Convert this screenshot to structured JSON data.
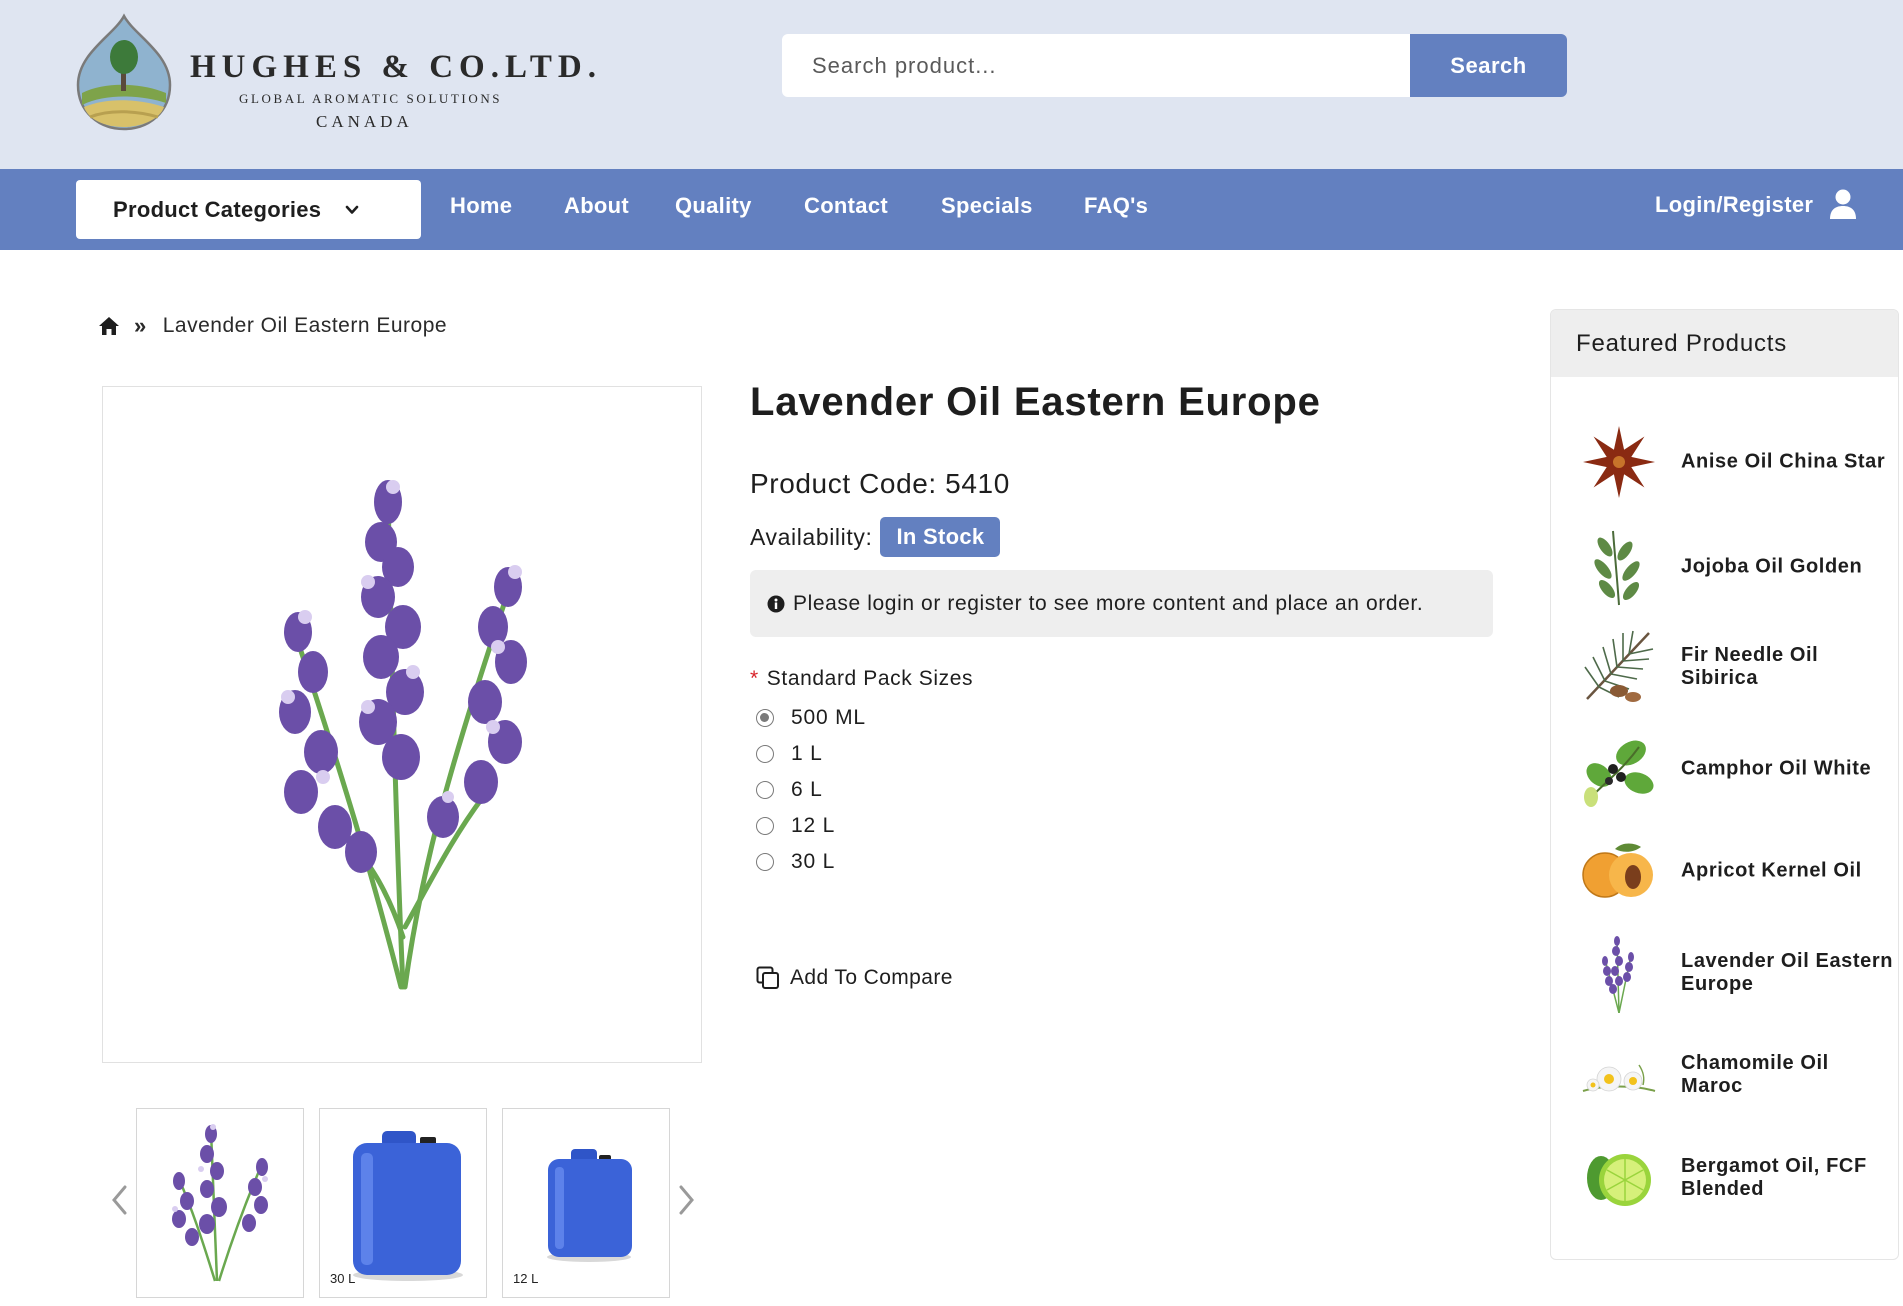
{
  "brand": {
    "name": "HUGHES & CO.LTD.",
    "tagline": "GLOBAL AROMATIC SOLUTIONS",
    "country": "CANADA"
  },
  "search": {
    "placeholder": "Search product...",
    "button_label": "Search"
  },
  "nav": {
    "categories_label": "Product Categories",
    "items": [
      {
        "label": "Home"
      },
      {
        "label": "About"
      },
      {
        "label": "Quality"
      },
      {
        "label": "Contact"
      },
      {
        "label": "Specials"
      },
      {
        "label": "FAQ's"
      }
    ],
    "login_label": "Login/Register"
  },
  "breadcrumb": {
    "separator": "»",
    "current": "Lavender Oil Eastern Europe"
  },
  "gallery": {
    "thumbs": [
      {
        "icon": "lavender-image",
        "label": ""
      },
      {
        "icon": "jerrycan-image",
        "label": "30 L"
      },
      {
        "icon": "jerrycan-image",
        "label": "12 L"
      }
    ]
  },
  "product": {
    "title": "Lavender Oil Eastern Europe",
    "code_text": "Product Code: 5410",
    "availability_label": "Availability:",
    "availability_value": "In Stock",
    "notice": "Please login or register to see more content and place an order.",
    "pack_title": "Standard Pack Sizes",
    "pack_required_mark": "*",
    "pack_sizes": [
      {
        "label": "500 ML",
        "selected": true
      },
      {
        "label": "1 L",
        "selected": false
      },
      {
        "label": "6 L",
        "selected": false
      },
      {
        "label": "12 L",
        "selected": false
      },
      {
        "label": "30 L",
        "selected": false
      }
    ],
    "compare_label": "Add To Compare"
  },
  "featured": {
    "title": "Featured Products",
    "items": [
      {
        "name": "Anise Oil China Star",
        "icon": "star-anise-image"
      },
      {
        "name": "Jojoba Oil Golden",
        "icon": "jojoba-image"
      },
      {
        "name": "Fir Needle Oil Sibirica",
        "icon": "fir-needle-image"
      },
      {
        "name": "Camphor Oil White",
        "icon": "camphor-image"
      },
      {
        "name": "Apricot Kernel Oil",
        "icon": "apricot-image"
      },
      {
        "name": "Lavender Oil Eastern Europe",
        "icon": "lavender-image"
      },
      {
        "name": "Chamomile Oil Maroc",
        "icon": "chamomile-image"
      },
      {
        "name": "Bergamot Oil, FCF Blended",
        "icon": "bergamot-image"
      }
    ]
  },
  "colors": {
    "header_bg": "#dfe5f1",
    "nav_bg": "#6380c0",
    "accent": "#6380c0",
    "panel_bg": "#eeeeee"
  }
}
